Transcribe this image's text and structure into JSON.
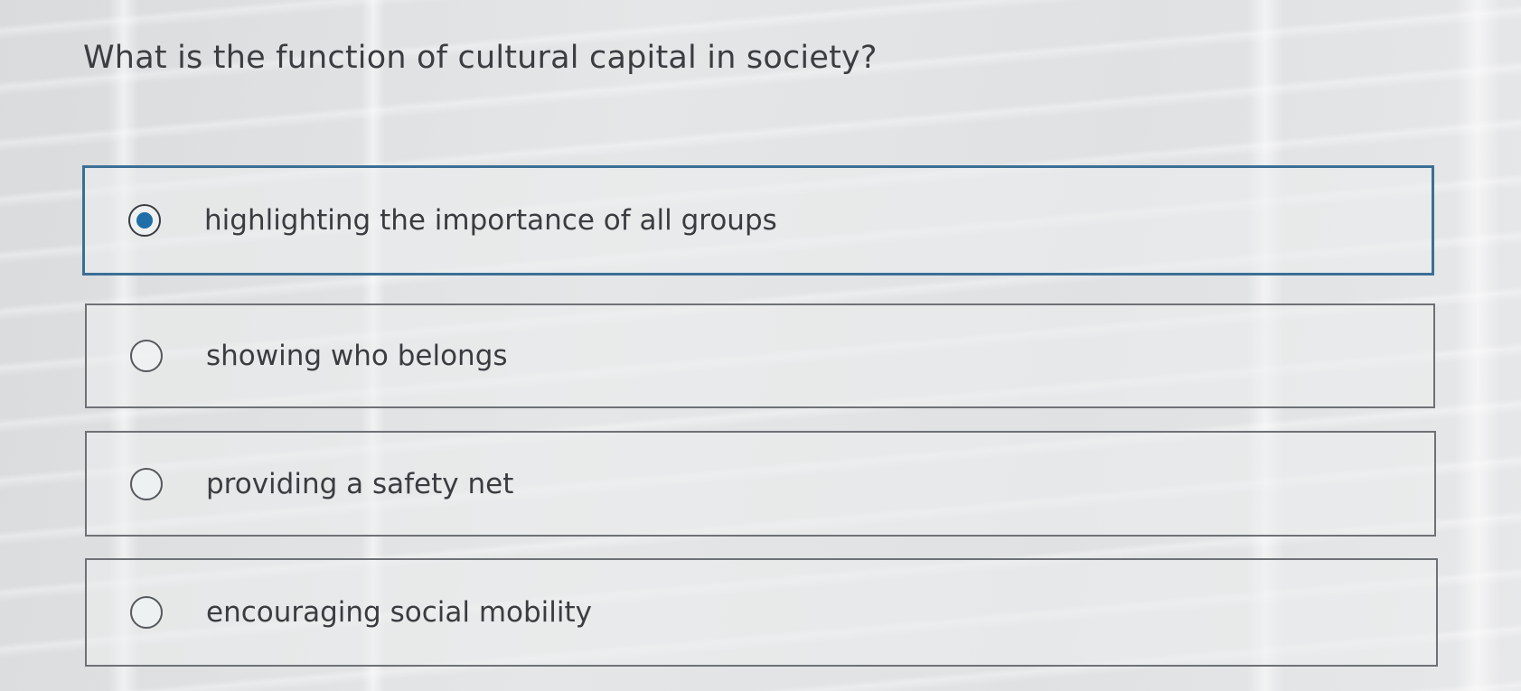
{
  "question": {
    "text": "What is the function of cultural capital in society?"
  },
  "options": [
    {
      "label": "highlighting the importance of all groups",
      "selected": true
    },
    {
      "label": "showing who belongs",
      "selected": false
    },
    {
      "label": "providing a safety net",
      "selected": false
    },
    {
      "label": "encouraging social mobility",
      "selected": false
    }
  ],
  "colors": {
    "selected_border": "#3b6f96",
    "radio_fill": "#1f6ea8",
    "border": "#6e7175",
    "text": "#3a3c40"
  }
}
